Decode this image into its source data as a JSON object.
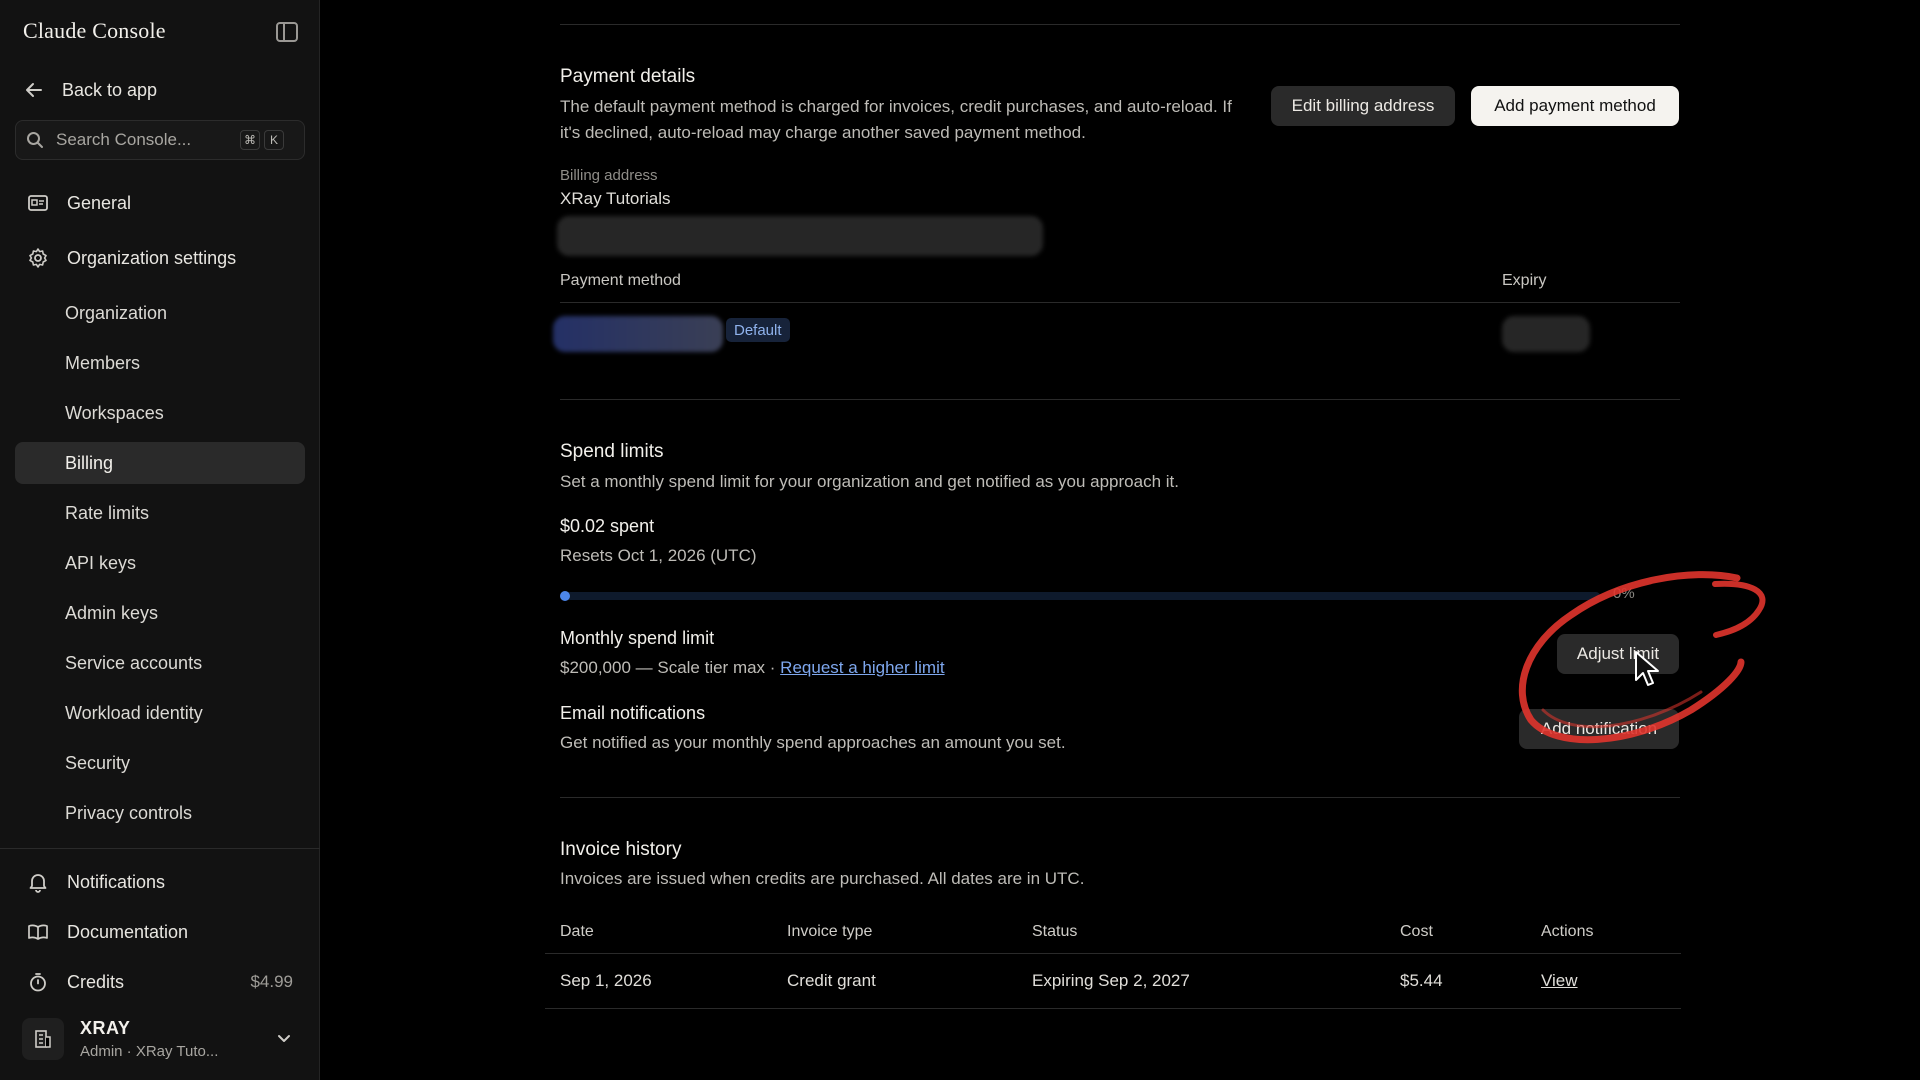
{
  "sidebar": {
    "brand": "Claude Console",
    "back": "Back to app",
    "search": {
      "placeholder": "Search Console...",
      "kbd1": "⌘",
      "kbd2": "K"
    },
    "general": "General",
    "org_settings": "Organization settings",
    "sub_items": [
      "Organization",
      "Members",
      "Workspaces",
      "Billing",
      "Rate limits",
      "API keys",
      "Admin keys",
      "Service accounts",
      "Workload identity",
      "Security",
      "Privacy controls"
    ],
    "active_item": "Billing",
    "notifications": "Notifications",
    "documentation": "Documentation",
    "credits": "Credits",
    "credits_amount": "$4.99",
    "org": {
      "name": "XRAY",
      "role": "Admin · XRay Tuto..."
    }
  },
  "payment": {
    "title": "Payment details",
    "desc": "The default payment method is charged for invoices, credit purchases, and auto-reload. If it's declined, auto-reload may charge another saved payment method.",
    "edit_billing": "Edit billing address",
    "add_payment": "Add payment method",
    "billing_address_label": "Billing address",
    "billing_address_name": "XRay Tutorials",
    "method_header": "Payment method",
    "expiry_header": "Expiry",
    "default_badge": "Default"
  },
  "spend": {
    "title": "Spend limits",
    "desc": "Set a monthly spend limit for your organization and get notified as you approach it.",
    "spent": "$0.02 spent",
    "resets": "Resets Oct 1, 2026 (UTC)",
    "progress_percent": 0,
    "progress_label": "0%",
    "monthly_title": "Monthly spend limit",
    "monthly_value": "$200,000 — Scale tier max · ",
    "request_link": "Request a higher limit",
    "adjust_button": "Adjust limit",
    "email_title": "Email notifications",
    "email_desc": "Get notified as your monthly spend approaches an amount you set.",
    "add_notification": "Add notification"
  },
  "invoices": {
    "title": "Invoice history",
    "desc": "Invoices are issued when credits are purchased. All dates are in UTC.",
    "columns": {
      "date": "Date",
      "type": "Invoice type",
      "status": "Status",
      "cost": "Cost",
      "actions": "Actions"
    },
    "rows": [
      {
        "date": "Sep 1, 2026",
        "type": "Credit grant",
        "status": "Expiring Sep 2, 2027",
        "cost": "$5.44",
        "action": "View"
      }
    ]
  },
  "colors": {
    "accent": "#3d7ae0",
    "annotation": "#e0342c",
    "link": "#7ea7ee"
  }
}
